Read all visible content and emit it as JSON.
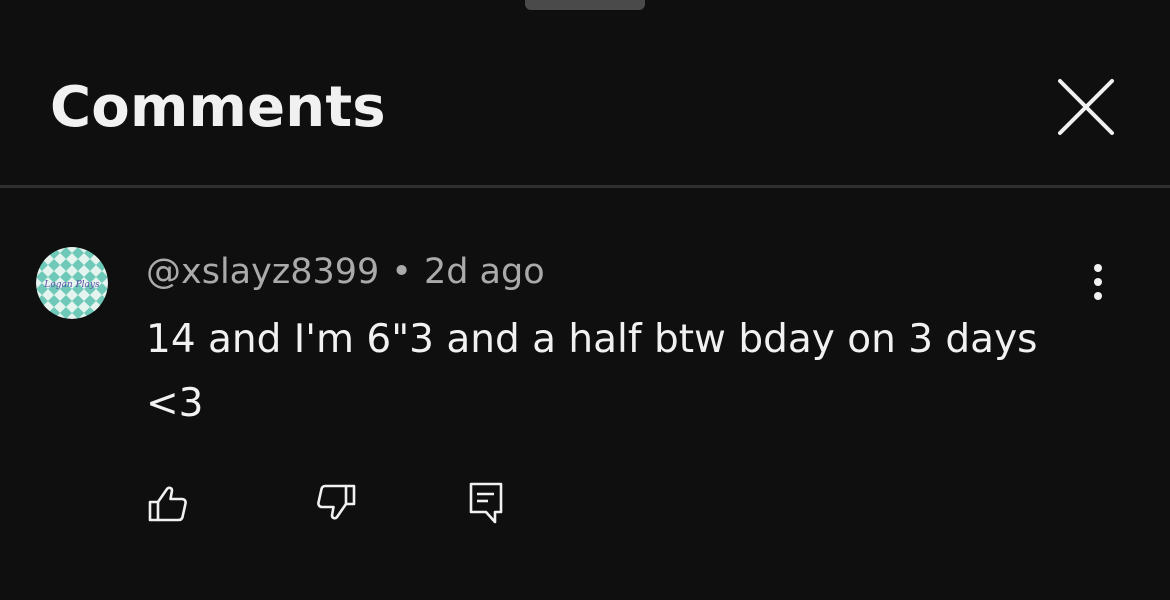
{
  "header": {
    "title": "Comments"
  },
  "comment": {
    "author": "@xslayz8399",
    "separator": "•",
    "time": "2d ago",
    "text": "14 and I'm 6\"3 and a half btw bday on 3 days <3",
    "avatar_text": "Logan Plays"
  },
  "icons": {
    "close": "close-icon",
    "more": "more-vertical-icon",
    "like": "thumbs-up-icon",
    "dislike": "thumbs-down-icon",
    "reply": "reply-comment-icon"
  },
  "colors": {
    "background": "#0f0f0f",
    "text_primary": "#f1f1f1",
    "text_secondary": "#aaaaaa",
    "divider": "#2e2e2e",
    "avatar_teal": "#6fc9b8",
    "avatar_light": "#e6f4f0"
  }
}
